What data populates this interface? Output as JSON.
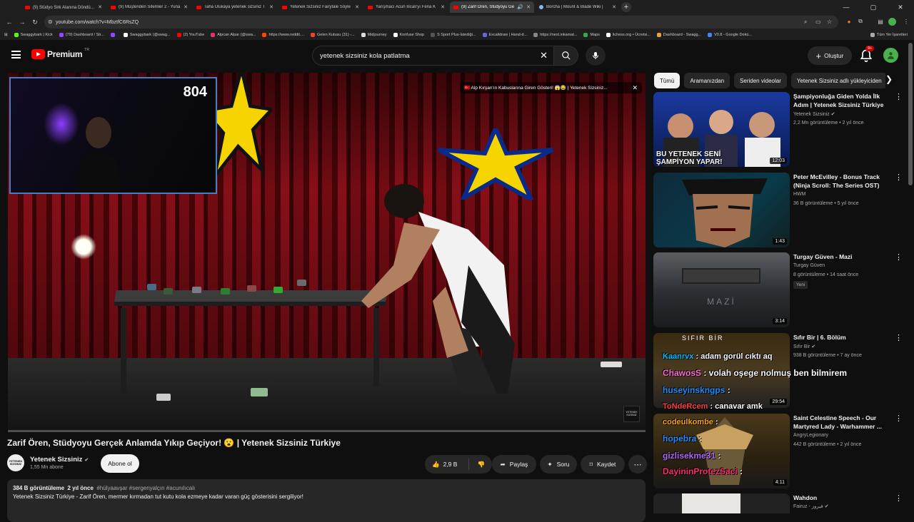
{
  "browser": {
    "tabs": [
      {
        "title": "(9) Stüdyo Sirk Alanına Döndü! 😱",
        "icon": "youtube"
      },
      {
        "title": "(9) Müşteriden Sitemler 2 - Yuna",
        "icon": "youtube"
      },
      {
        "title": "Taha Ulukaya yetenek sizsiniz T",
        "icon": "youtube"
      },
      {
        "title": "Yetenek Sizsiniz Fairytale Söyle",
        "icon": "youtube"
      },
      {
        "title": "Yarışmacı Acun Ilıcalı'yı Fena K",
        "icon": "youtube"
      },
      {
        "title": "(9) Zarif Ören, Stüdyoyu Ge",
        "icon": "youtube",
        "active": true
      },
      {
        "title": "Borcha | Mount & Blade Wiki |",
        "icon": "wiki"
      }
    ],
    "url": "youtube.com/watch?v=MbztfC6RsZQ",
    "bookmarks": [
      "Swaggybark | Kick",
      "(79) Dashboard / Str...",
      "",
      "Swaggybark (@swag...",
      "(2) YouTube",
      "Alpcan Alpar (@swa...",
      "https://www.reddit....",
      "Gelen Kutusu (31) -...",
      "Midjourney",
      "Konfuse Shop",
      "S Sport Plus-İstediği...",
      "Excalidraw | Hand-d...",
      "https://next.inkamat...",
      "Maps",
      "lichess.org • Ücretsi...",
      "Dashboard - Swagg...",
      "V0.8 - Google Dokü..."
    ],
    "all_bookmarks": "Tüm Yer İşaretleri"
  },
  "youtube": {
    "logo_text": "Premium",
    "logo_region": "TR",
    "search_query": "yetenek sizsiniz kola patlatma",
    "create_label": "Oluştur",
    "notif_badge": "9+",
    "accent": "#ff0000"
  },
  "player": {
    "webcam_counter": "804",
    "endcard_title": "🇹🇷 Alp Kırşan'ın Kabuslarına Giren Gösteri! 😱😂 | Yetenek Sizsiniz...",
    "watermark": "YETENEK SİZSİNİZ",
    "progress": 0.0
  },
  "video": {
    "title": "Zarif Ören, Stüdyoyu Gerçek Anlamda Yıkıp Geçiyor! 😮 | Yetenek Sizsiniz Türkiye",
    "channel": "Yetenek Sizsiniz",
    "subscribers": "1,55 Mn abone",
    "channel_avatar_text": "YETENEK SİZSİNİZ",
    "subscribe_label": "Abone ol",
    "likes": "2,9 B",
    "share_label": "Paylaş",
    "ask_label": "Soru",
    "save_label": "Kaydet",
    "views": "384 B görüntüleme",
    "age": "2 yıl önce",
    "hashtags": "#hülyaavşar #sergenyalçın #acunılıcalı",
    "description": "Yetenek Sizsiniz Türkiye - Zarif Ören, mermer kırmadan tut kutu kola ezmeye kadar varan güç gösterisini sergiliyor!"
  },
  "chips": [
    "Tümü",
    "Aramanızdan",
    "Seriden videolar",
    "Yetenek Sizsiniz adlı yükleyiciden"
  ],
  "recommendations": [
    {
      "title": "Şampiyonluğa Giden Yolda İlk Adım | Yetenek Sizsiniz Türkiye",
      "channel": "Yetenek Sizsiniz",
      "verified": true,
      "meta": "2,2 Mn görüntüleme • 2 yıl önce",
      "duration": "12:03",
      "thumb_text": "BU YETENEK SENİ ŞAMPİYON YAPAR!"
    },
    {
      "title": "Peter McEvilley - Bonus Track (Ninja Scroll: The Series OST)",
      "channel": "HWM",
      "verified": false,
      "meta": "36 B görüntüleme • 5 yıl önce",
      "duration": "1:43"
    },
    {
      "title": "Turgay Güven - Mazi",
      "channel": "Turgay Güven",
      "verified": false,
      "meta": "8 görüntüleme • 14 saat önce",
      "duration": "3:14",
      "badge": "Yeni",
      "thumb_text": "MAZİ"
    },
    {
      "title": "Sıfır Bir | 6. Bölüm",
      "channel": "Sıfır Bir",
      "verified": true,
      "meta": "938 B görüntüleme • 7 ay önce",
      "duration": "29:54",
      "thumb_text": "SIFIR BİR"
    },
    {
      "title": "Saint Celestine Speech - Our Martyred Lady - Warhammer ...",
      "channel": "AngryLegionary",
      "verified": false,
      "meta": "442 B görüntüleme • 2 yıl önce",
      "duration": "4:11"
    },
    {
      "title": "Wahdon",
      "channel": "Fairuz - فيروز",
      "verified": true,
      "meta": "",
      "duration": ""
    }
  ],
  "chat_overlay": [
    {
      "user": "Kaanrvx",
      "msg": ": adam gorül cıktı aq",
      "color": "#00bfff"
    },
    {
      "user": "ChawosS",
      "msg": ": volah oşege nolmuş ben bilmirem",
      "color": "#ff6bd5"
    },
    {
      "user": "huseyinskngps",
      "msg": ":",
      "color": "#1e90ff"
    },
    {
      "user": "ToNdeRcem",
      "msg": ": canavar amk",
      "color": "#ff4040"
    },
    {
      "user": "codeulkombe",
      "msg": ":",
      "color": "#ffa500"
    },
    {
      "user": "hopebra",
      "msg": ":",
      "color": "#1e90ff"
    },
    {
      "user": "gizlisekme31",
      "msg": ":",
      "color": "#b266ff"
    },
    {
      "user": "DayininProtezSaci",
      "msg": ":",
      "color": "#ff2a6d"
    }
  ]
}
